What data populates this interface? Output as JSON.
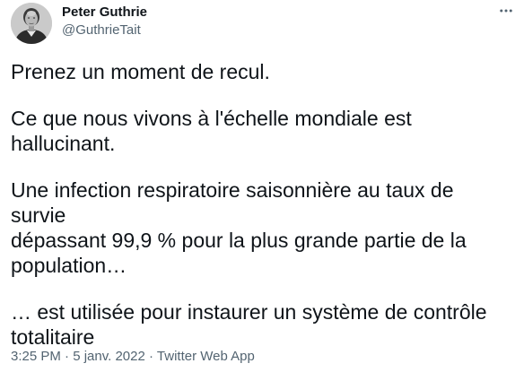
{
  "author": {
    "display_name": "Peter Guthrie",
    "handle": "@GuthrieTait",
    "avatar_icon": "portrait-avatar-icon"
  },
  "menu": {
    "more_icon": "more-dots-icon"
  },
  "tweet": {
    "paragraphs": [
      "Prenez un moment de recul.",
      "Ce que nous vivons à l'échelle mondiale est\nhallucinant.",
      "Une infection respiratoire saisonnière au taux de survie\ndépassant 99,9 % pour la plus grande partie de la\npopulation…",
      "… est utilisée pour instaurer un système de contrôle\ntotalitaire"
    ]
  },
  "meta": {
    "time": "3:25 PM",
    "separator": " · ",
    "date": "5 janv. 2022",
    "source": "Twitter Web App"
  },
  "colors": {
    "text": "#0f1419",
    "secondary": "#536471",
    "background": "#ffffff"
  }
}
